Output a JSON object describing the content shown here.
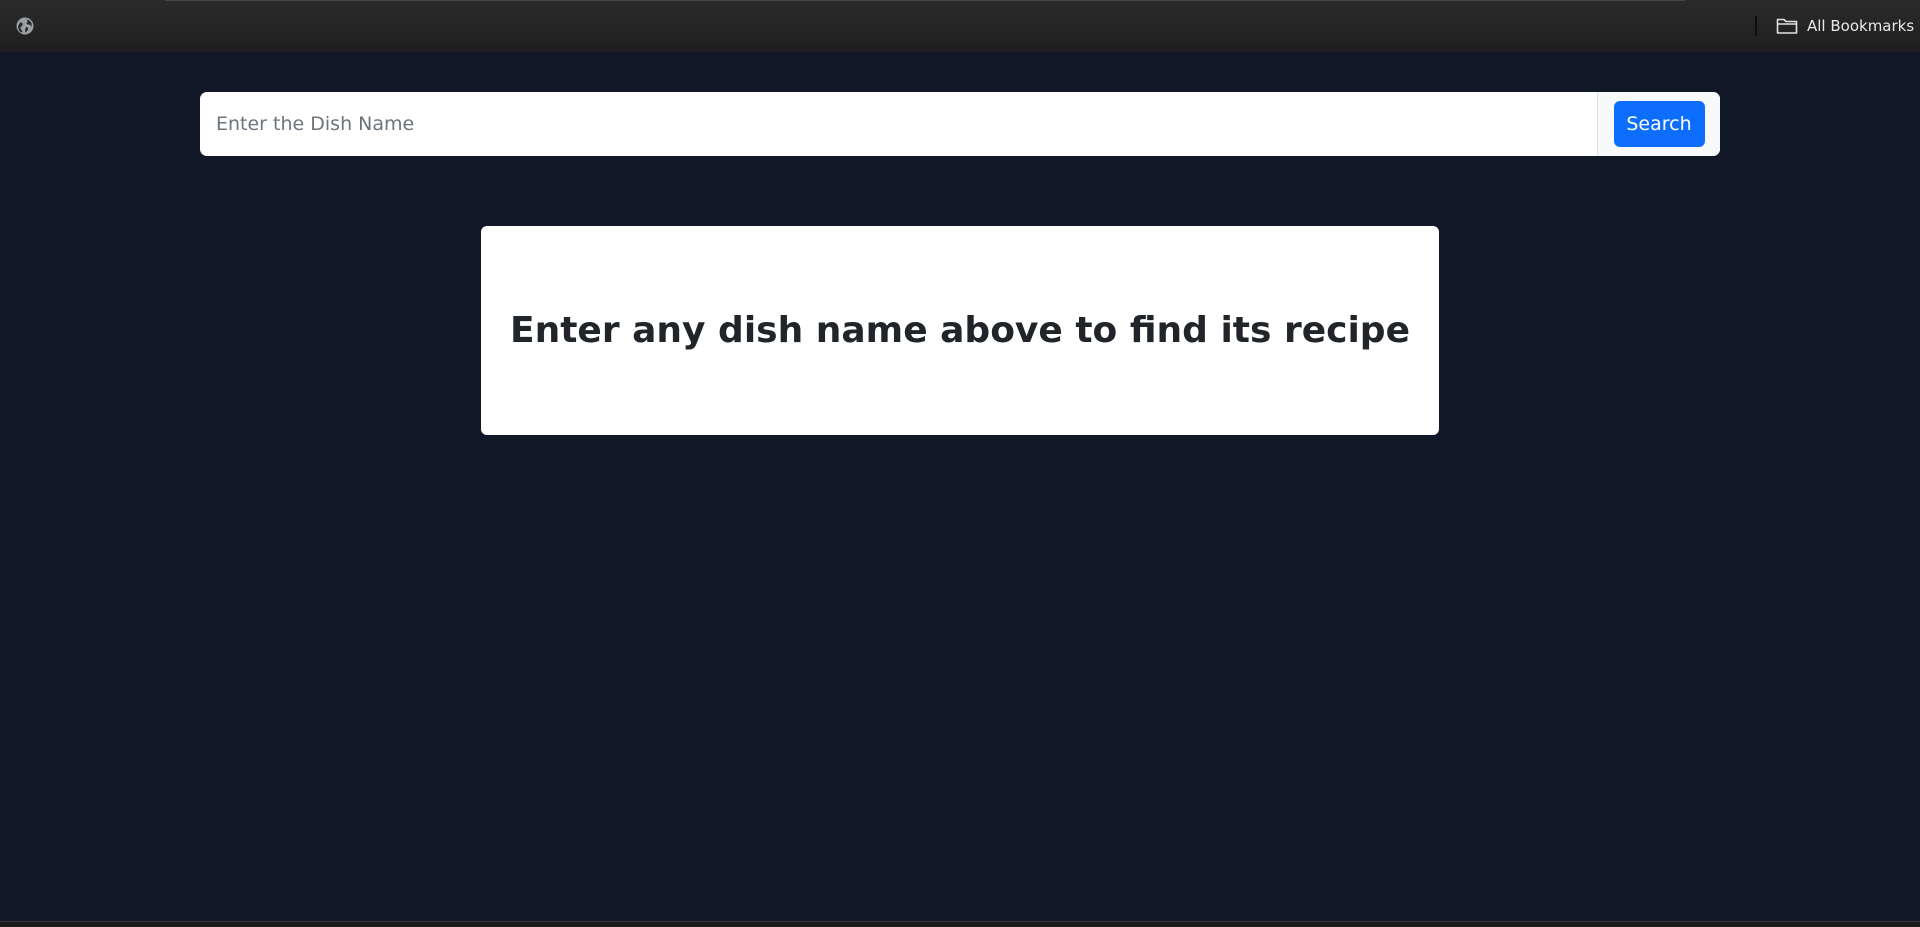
{
  "browser": {
    "bookmarks_bar": {
      "site_icon": "globe-icon",
      "all_bookmarks": {
        "icon": "folder-icon",
        "label": "All Bookmarks"
      }
    }
  },
  "search": {
    "value": "",
    "placeholder": "Enter the Dish Name",
    "button_label": "Search"
  },
  "prompt": {
    "message": "Enter any dish name above to find its recipe"
  },
  "colors": {
    "page_background": "#111827",
    "button_primary": "#0d6efd",
    "card_background": "#ffffff",
    "text_dark": "#212529"
  }
}
